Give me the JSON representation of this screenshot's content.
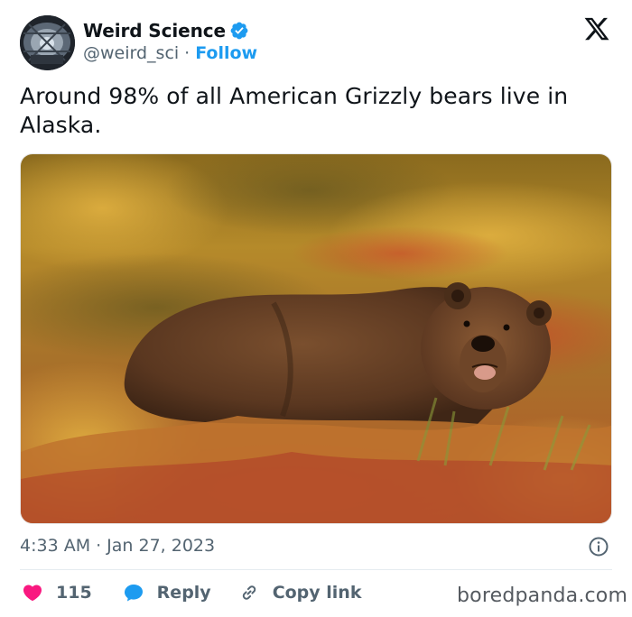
{
  "author": {
    "display_name": "Weird Science",
    "handle": "@weird_sci",
    "separator": "·",
    "follow_label": "Follow",
    "verified": true,
    "avatar_icon": "avatar-photo"
  },
  "tweet": {
    "text": "Around 98% of all American Grizzly bears live in Alaska.",
    "image_icon": "grizzly-bear-photo"
  },
  "meta": {
    "time": "4:33 AM",
    "separator": "·",
    "date": "Jan 27, 2023"
  },
  "actions": {
    "like_count": "115",
    "reply_label": "Reply",
    "copy_link_label": "Copy link"
  },
  "watermark": "boredpanda.com",
  "colors": {
    "accent": "#1d9bf0",
    "like": "#f91880",
    "muted": "#536471"
  }
}
